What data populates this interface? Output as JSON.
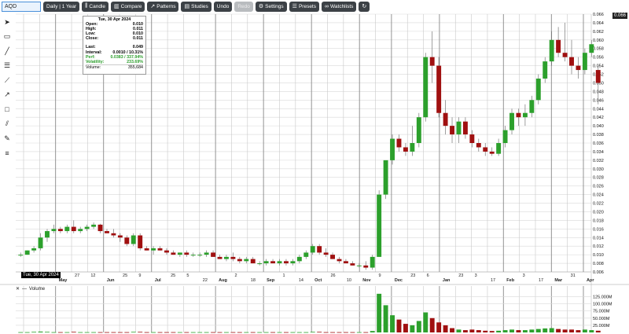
{
  "toolbar": {
    "symbol": "AQD",
    "interval_label": "Daily | 1 Year",
    "candle_label": "Candle",
    "compare_label": "Compare",
    "patterns_label": "Patterns",
    "studies_label": "Studies",
    "undo_label": "Undo",
    "redo_label": "Redo",
    "settings_label": "Settings",
    "presets_label": "Presets",
    "watchlists_label": "Watchlists"
  },
  "tools": [
    "cursor-icon",
    "annotation-icon",
    "line-icon",
    "fib-icon",
    "fan-icon",
    "arrow-icon",
    "rectangle-icon",
    "channel-icon",
    "paint-icon",
    "list-icon"
  ],
  "infobox": {
    "date": "Tue, 30 Apr 2024",
    "open_label": "Open:",
    "open": "0.010",
    "high_label": "High:",
    "high": "0.011",
    "low_label": "Low:",
    "low": "0.010",
    "close_label": "Close:",
    "close": "0.011",
    "last_label": "Last:",
    "last": "0.049",
    "interval_label": "Interval:",
    "interval": "0.0010 / 10.31%",
    "perf_label": "Perf:",
    "perf": "0.0383 / 337.94%",
    "volatility_label": "Volatility:",
    "volatility": "233.69%",
    "volume_label": "Volume:",
    "volume": "355,684"
  },
  "date_tag": "Tue, 30 Apr 2024",
  "price_badge": "0.066",
  "volume_title": "Volume",
  "colors": {
    "up": "#2ca02c",
    "down": "#a01010",
    "grid": "#d9d9d9",
    "vline": "#999999"
  },
  "chart_data": {
    "type": "candlestick",
    "y_ticks": [
      "0.066",
      "0.064",
      "0.062",
      "0.060",
      "0.058",
      "0.056",
      "0.054",
      "0.052",
      "0.050",
      "0.048",
      "0.046",
      "0.044",
      "0.042",
      "0.040",
      "0.038",
      "0.036",
      "0.034",
      "0.032",
      "0.030",
      "0.028",
      "0.026",
      "0.024",
      "0.022",
      "0.020",
      "0.018",
      "0.016",
      "0.014",
      "0.012",
      "0.010",
      "0.008",
      "0.006"
    ],
    "ylim": [
      0.006,
      0.066
    ],
    "x_labels": [
      {
        "label": "17",
        "bold": false
      },
      {
        "label": "13",
        "bold": false
      },
      {
        "label": "May",
        "bold": true
      },
      {
        "label": "27",
        "bold": false
      },
      {
        "label": "12",
        "bold": false
      },
      {
        "label": "Jun",
        "bold": true
      },
      {
        "label": "25",
        "bold": false
      },
      {
        "label": "9",
        "bold": false
      },
      {
        "label": "Jul",
        "bold": true
      },
      {
        "label": "25",
        "bold": false
      },
      {
        "label": "5",
        "bold": false
      },
      {
        "label": "22",
        "bold": false
      },
      {
        "label": "Aug",
        "bold": true
      },
      {
        "label": "2",
        "bold": false
      },
      {
        "label": "18",
        "bold": false
      },
      {
        "label": "Sep",
        "bold": true
      },
      {
        "label": "1",
        "bold": false
      },
      {
        "label": "14",
        "bold": false
      },
      {
        "label": "Oct",
        "bold": true
      },
      {
        "label": "26",
        "bold": false
      },
      {
        "label": "10",
        "bold": false
      },
      {
        "label": "Nov",
        "bold": true
      },
      {
        "label": "9",
        "bold": false
      },
      {
        "label": "Dec",
        "bold": true
      },
      {
        "label": "23",
        "bold": false
      },
      {
        "label": "6",
        "bold": false
      },
      {
        "label": "Jan",
        "bold": true
      },
      {
        "label": "23",
        "bold": false
      },
      {
        "label": "3",
        "bold": false
      },
      {
        "label": "17",
        "bold": false
      },
      {
        "label": "Feb",
        "bold": true
      },
      {
        "label": "3",
        "bold": false
      },
      {
        "label": "17",
        "bold": false
      },
      {
        "label": "Mar",
        "bold": true
      },
      {
        "label": "31",
        "bold": false
      },
      {
        "label": "Apr",
        "bold": true
      }
    ],
    "volume_ticks": [
      "125.000M",
      "100.000M",
      "75.000M",
      "50.000M",
      "25.000M"
    ],
    "volume_ylim": [
      0,
      140
    ],
    "candles": [
      [
        0.01,
        0.0105,
        0.0095,
        0.01,
        1
      ],
      [
        0.01,
        0.011,
        0.01,
        0.011,
        1
      ],
      [
        0.011,
        0.012,
        0.0105,
        0.0115,
        2
      ],
      [
        0.0115,
        0.015,
        0.011,
        0.014,
        3
      ],
      [
        0.014,
        0.016,
        0.013,
        0.0155,
        2
      ],
      [
        0.0155,
        0.017,
        0.015,
        0.016,
        1
      ],
      [
        0.016,
        0.0165,
        0.015,
        0.0155,
        1
      ],
      [
        0.0155,
        0.017,
        0.015,
        0.0165,
        1
      ],
      [
        0.0165,
        0.018,
        0.015,
        0.0155,
        2
      ],
      [
        0.0155,
        0.0165,
        0.015,
        0.016,
        1
      ],
      [
        0.016,
        0.017,
        0.0155,
        0.0165,
        1
      ],
      [
        0.0165,
        0.0175,
        0.016,
        0.017,
        1
      ],
      [
        0.017,
        0.0172,
        0.015,
        0.0155,
        1
      ],
      [
        0.0155,
        0.016,
        0.015,
        0.015,
        1
      ],
      [
        0.015,
        0.016,
        0.014,
        0.0145,
        1
      ],
      [
        0.0145,
        0.015,
        0.013,
        0.014,
        1
      ],
      [
        0.014,
        0.0145,
        0.012,
        0.0125,
        1
      ],
      [
        0.0125,
        0.015,
        0.012,
        0.0145,
        2
      ],
      [
        0.0145,
        0.015,
        0.011,
        0.0115,
        2
      ],
      [
        0.0115,
        0.012,
        0.011,
        0.011,
        1
      ],
      [
        0.011,
        0.012,
        0.01,
        0.0115,
        1
      ],
      [
        0.0115,
        0.012,
        0.011,
        0.011,
        1
      ],
      [
        0.011,
        0.0115,
        0.01,
        0.0105,
        1
      ],
      [
        0.0105,
        0.011,
        0.01,
        0.01,
        1
      ],
      [
        0.01,
        0.0105,
        0.0095,
        0.0105,
        1
      ],
      [
        0.0105,
        0.011,
        0.0095,
        0.01,
        1
      ],
      [
        0.01,
        0.0105,
        0.0095,
        0.01,
        1
      ],
      [
        0.01,
        0.0105,
        0.0095,
        0.01,
        1
      ],
      [
        0.01,
        0.011,
        0.0095,
        0.0105,
        1
      ],
      [
        0.0105,
        0.011,
        0.0095,
        0.0095,
        1
      ],
      [
        0.0095,
        0.01,
        0.009,
        0.009,
        1
      ],
      [
        0.009,
        0.01,
        0.0085,
        0.0095,
        1
      ],
      [
        0.0095,
        0.0105,
        0.0085,
        0.009,
        1
      ],
      [
        0.009,
        0.0095,
        0.008,
        0.0085,
        1
      ],
      [
        0.0085,
        0.0095,
        0.008,
        0.009,
        1
      ],
      [
        0.009,
        0.0095,
        0.008,
        0.008,
        1
      ],
      [
        0.008,
        0.0085,
        0.0075,
        0.008,
        1
      ],
      [
        0.008,
        0.009,
        0.0075,
        0.0085,
        1
      ],
      [
        0.0085,
        0.009,
        0.008,
        0.008,
        1
      ],
      [
        0.008,
        0.009,
        0.0075,
        0.0085,
        1
      ],
      [
        0.0085,
        0.009,
        0.0075,
        0.008,
        1
      ],
      [
        0.008,
        0.009,
        0.0075,
        0.0085,
        1
      ],
      [
        0.0085,
        0.01,
        0.008,
        0.0095,
        1
      ],
      [
        0.0095,
        0.011,
        0.009,
        0.0105,
        1
      ],
      [
        0.0105,
        0.0125,
        0.01,
        0.012,
        2
      ],
      [
        0.012,
        0.0125,
        0.01,
        0.0105,
        2
      ],
      [
        0.0105,
        0.0115,
        0.0095,
        0.01,
        1
      ],
      [
        0.01,
        0.0105,
        0.009,
        0.009,
        1
      ],
      [
        0.009,
        0.0095,
        0.008,
        0.0085,
        1
      ],
      [
        0.0085,
        0.009,
        0.008,
        0.008,
        1
      ],
      [
        0.008,
        0.0085,
        0.0075,
        0.0075,
        1
      ],
      [
        0.0075,
        0.008,
        0.007,
        0.0075,
        1
      ],
      [
        0.0075,
        0.0085,
        0.0065,
        0.007,
        1
      ],
      [
        0.007,
        0.01,
        0.0065,
        0.0095,
        5
      ],
      [
        0.0095,
        0.025,
        0.0095,
        0.024,
        135
      ],
      [
        0.024,
        0.03,
        0.023,
        0.032,
        95
      ],
      [
        0.032,
        0.038,
        0.031,
        0.037,
        60
      ],
      [
        0.037,
        0.038,
        0.034,
        0.035,
        45
      ],
      [
        0.035,
        0.036,
        0.033,
        0.034,
        30
      ],
      [
        0.034,
        0.04,
        0.033,
        0.036,
        25
      ],
      [
        0.036,
        0.043,
        0.035,
        0.042,
        40
      ],
      [
        0.042,
        0.057,
        0.041,
        0.056,
        70
      ],
      [
        0.056,
        0.062,
        0.05,
        0.054,
        50
      ],
      [
        0.054,
        0.056,
        0.042,
        0.043,
        35
      ],
      [
        0.043,
        0.046,
        0.038,
        0.04,
        25
      ],
      [
        0.04,
        0.042,
        0.036,
        0.038,
        15
      ],
      [
        0.038,
        0.042,
        0.036,
        0.041,
        10
      ],
      [
        0.041,
        0.042,
        0.037,
        0.038,
        8
      ],
      [
        0.038,
        0.039,
        0.035,
        0.036,
        10
      ],
      [
        0.036,
        0.037,
        0.034,
        0.035,
        8
      ],
      [
        0.035,
        0.036,
        0.033,
        0.034,
        6
      ],
      [
        0.034,
        0.035,
        0.033,
        0.0335,
        5
      ],
      [
        0.0335,
        0.037,
        0.033,
        0.036,
        6
      ],
      [
        0.036,
        0.04,
        0.035,
        0.039,
        8
      ],
      [
        0.039,
        0.044,
        0.038,
        0.043,
        10
      ],
      [
        0.043,
        0.044,
        0.04,
        0.042,
        8
      ],
      [
        0.042,
        0.045,
        0.04,
        0.043,
        8
      ],
      [
        0.043,
        0.047,
        0.042,
        0.046,
        10
      ],
      [
        0.046,
        0.052,
        0.045,
        0.051,
        12
      ],
      [
        0.051,
        0.056,
        0.05,
        0.055,
        14
      ],
      [
        0.055,
        0.062,
        0.054,
        0.06,
        15
      ],
      [
        0.06,
        0.063,
        0.056,
        0.057,
        12
      ],
      [
        0.057,
        0.064,
        0.055,
        0.056,
        10
      ],
      [
        0.056,
        0.06,
        0.052,
        0.054,
        10
      ],
      [
        0.054,
        0.056,
        0.051,
        0.053,
        8
      ],
      [
        0.053,
        0.058,
        0.052,
        0.057,
        10
      ],
      [
        0.057,
        0.06,
        0.056,
        0.059,
        8
      ],
      [
        0.053,
        0.054,
        0.045,
        0.05,
        6
      ]
    ]
  }
}
